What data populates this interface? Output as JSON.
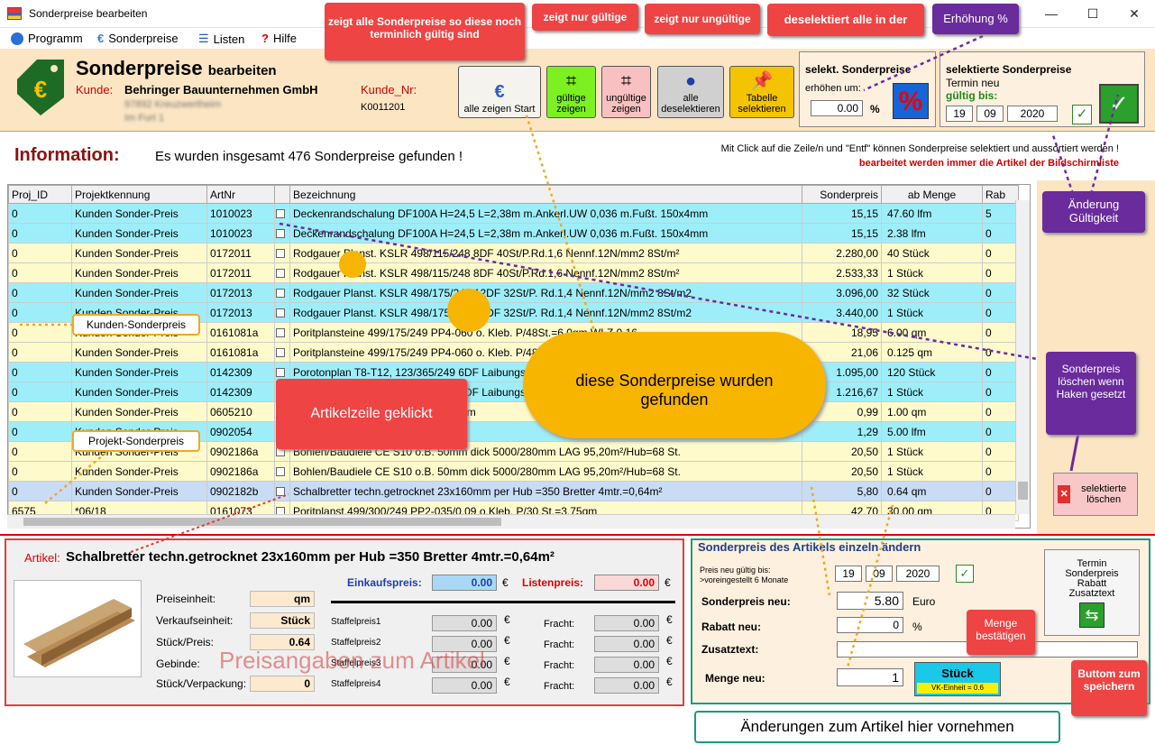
{
  "window": {
    "title": "Sonderpreise bearbeiten",
    "min": "—",
    "max": "☐",
    "close": "✕"
  },
  "menu": [
    {
      "label": "Programm",
      "color": "#2a6fd6"
    },
    {
      "label": "Sonderpreise",
      "color": "#3a7bd5"
    },
    {
      "label": "Listen",
      "color": "#1b5fb5"
    },
    {
      "label": "Hilfe",
      "color": "#d00000"
    }
  ],
  "header": {
    "title": "Sonderpreise",
    "title_suffix": "bearbeiten",
    "kunde_label": "Kunde:",
    "kunde_value": "Behringer Bauunternehmen GmbH",
    "address1": "97892 Kreuzwertheim",
    "address2": "Im Furt 1",
    "kundennr_label": "Kunde_Nr:",
    "kundennr_value": "K0011201"
  },
  "toolbar": {
    "alle_zeigen": "alle zeigen Start",
    "gueltige": "gültige zeigen",
    "ungueltige": "ungültige zeigen",
    "deselektieren": "alle deselektieren",
    "tabelle": "Tabelle selektieren"
  },
  "erhoehen": {
    "title": "selekt. Sonderpreise",
    "label": "erhöhen um:",
    "value": "0.00",
    "unit": "%"
  },
  "termin": {
    "title": "selektierte Sonderpreise",
    "line2": "Termin neu",
    "line3": "gültig bis:",
    "day": "19",
    "month": "09",
    "year": "2020"
  },
  "info": {
    "label": "Information:",
    "text": "Es wurden insgesamt  476  Sonderpreise gefunden !",
    "hint": "Mit Click auf die Zeile/n und \"Entf\" können Sonderpreise selektiert und aussortiert werden !",
    "hint2": "bearbeitet werden immer die Artikel der Bildschirmliste"
  },
  "table": {
    "columns": [
      "Proj_ID",
      "Projektkennung",
      "ArtNr",
      "",
      "Bezeichnung",
      "Sonderpreis",
      "ab Menge",
      "Rab"
    ],
    "rows": [
      {
        "style": "cyan",
        "c": [
          "0",
          "Kunden Sonder-Preis",
          "1010023",
          "Deckenrandschalung DF100A  H=24,5 L=2,38m  m.Ankerl.UW 0,036 m.Fußt. 150x4mm",
          "15,15",
          "47.60 lfm",
          "5"
        ]
      },
      {
        "style": "cyan",
        "c": [
          "0",
          "Kunden Sonder-Preis",
          "1010023",
          "Deckenrandschalung DF100A  H=24,5 L=2,38m  m.Ankerl.UW 0,036  m.Fußt.  150x4mm",
          "15,15",
          "2.38 lfm",
          "0"
        ]
      },
      {
        "style": "yel",
        "c": [
          "0",
          "Kunden Sonder-Preis",
          "0172011",
          "Rodgauer Planst.  KSLR 498/115/248   8DF 40St/P.Rd.1,6 Nennf.12N/mm2 8St/m²",
          "2.280,00",
          "40 Stück",
          "0"
        ]
      },
      {
        "style": "yel",
        "c": [
          "0",
          "Kunden Sonder-Preis",
          "0172011",
          "Rodgauer Planst.  KSLR 498/115/248   8DF 40St/P.Rd.1,6 Nennf.12N/mm2 8St/m²",
          "2.533,33",
          "1 Stück",
          "0"
        ]
      },
      {
        "style": "cyan",
        "c": [
          "0",
          "Kunden Sonder-Preis",
          "0172013",
          "Rodgauer Planst. KSLR 498/175/248  12DF 32St/P. Rd.1,4 Nennf.12N/mm2 8St/m2",
          "3.096,00",
          "32 Stück",
          "0"
        ]
      },
      {
        "style": "cyan",
        "c": [
          "0",
          "Kunden Sonder-Preis",
          "0172013",
          "Rodgauer Planst. KSLR 498/175/248  12DF 32St/P. Rd.1,4 Nennf.12N/mm2 8St/m2",
          "3.440,00",
          "1 Stück",
          "0"
        ]
      },
      {
        "style": "yel",
        "c": [
          "0",
          "Kunden Sonder-Preis",
          "0161081a",
          "Poritplansteine 499/175/249   PP4-060  o. Kleb. P/48St.=6,0qm WLZ 0,16",
          "18,95",
          "6.00 qm",
          "0"
        ]
      },
      {
        "style": "yel",
        "c": [
          "0",
          "Kunden Sonder-Preis",
          "0161081a",
          "Poritplansteine 499/175/249   PP4-060  o. Kleb. P/48St.",
          "21,06",
          "0.125 qm",
          "0"
        ]
      },
      {
        "style": "cyan",
        "c": [
          "0",
          "Kunden Sonder-Preis",
          "0142309",
          "Porotonplan T8-T12,   123/365/249 6DF Laibungsz.",
          "1.095,00",
          "120 Stück",
          "0"
        ]
      },
      {
        "style": "cyan",
        "c": [
          "0",
          "Kunden Sonder-Preis",
          "0142309",
          "Porotonplan T8-T12,   123/365/249 6DF Laibungsz.",
          "1.216,67",
          "1 Stück",
          "0"
        ]
      },
      {
        "style": "yel",
        "c": [
          "0",
          "Kunden Sonder-Preis",
          "0605210",
          "Bohlen/Baudiele CE S10 o.B. 36,5 cm",
          "0,99",
          "1.00 qm",
          "0"
        ]
      },
      {
        "style": "cyan",
        "c": [
          "0",
          "Kunden Sonder-Preis",
          "0902054",
          "Schalbretter techn.getr. 5,0",
          "1,29",
          "5.00 lfm",
          "0"
        ]
      },
      {
        "style": "yel",
        "c": [
          "0",
          "Kunden Sonder-Preis",
          "0902186a",
          "Bohlen/Baudiele CE S10 o.B. 50mm dick 5000/280mm LAG 95,20m²/Hub=68 St.",
          "20,50",
          "1 Stück",
          "0"
        ]
      },
      {
        "style": "yel",
        "c": [
          "0",
          "Kunden Sonder-Preis",
          "0902186a",
          "Bohlen/Baudiele CE S10 o.B. 50mm dick 5000/280mm LAG 95,20m²/Hub=68 St.",
          "20,50",
          "1 Stück",
          "0"
        ]
      },
      {
        "style": "sel",
        "c": [
          "0",
          "Kunden Sonder-Preis",
          "0902182b",
          "Schalbretter techn.getrocknet 23x160mm per Hub =350 Bretter 4mtr.=0,64m²",
          "5,80",
          "0.64 qm",
          "0"
        ]
      },
      {
        "style": "yel",
        "c": [
          "6575",
          "*06/18",
          "0161073",
          "Poritplanst.499/300/249  PP2-035/0,09 o.Kleb. P/30 St.=3,75qm",
          "42,70",
          "30.00 qm",
          "0"
        ]
      }
    ]
  },
  "delete_button": "selektierte löschen",
  "artikel": {
    "label": "Artikel:",
    "name": "Schalbretter techn.getrocknet 23x160mm per Hub =350 Bretter 4mtr.=0,64m²",
    "einkauf_label": "Einkaufspreis:",
    "einkauf_value": "0.00",
    "listen_label": "Listenpreis:",
    "listen_value": "0.00",
    "currency": "€",
    "preiseinheit_label": "Preiseinheit:",
    "preiseinheit_value": "qm",
    "verkaufseinheit_label": "Verkaufseinheit:",
    "verkaufseinheit_value": "Stück",
    "stueck_preis_label": "Stück/Preis:",
    "stueck_preis_value": "0.64",
    "gebinde_label": "Gebinde:",
    "stueck_verpackung_label": "Stück/Verpackung:",
    "stueck_verpackung_value": "0",
    "staffel": [
      {
        "label": "Staffelpreis1",
        "value": "0.00",
        "fracht": "0.00"
      },
      {
        "label": "Staffelpreis2",
        "value": "0.00",
        "fracht": "0.00"
      },
      {
        "label": "Staffelpreis3",
        "value": "0.00",
        "fracht": "0.00"
      },
      {
        "label": "Staffelpreis4",
        "value": "0.00",
        "fracht": "0.00"
      }
    ],
    "fracht_label": "Fracht:",
    "watermark": "Preisangaben zum Artikel"
  },
  "einzel": {
    "title": "Sonderpreis des Artikels einzeln ändern",
    "gueltig_label1": "Preis neu gültig bis:",
    "gueltig_label2": ">voreingestellt 6 Monate",
    "day": "19",
    "month": "09",
    "year": "2020",
    "sonderpreis_label": "Sonderpreis neu:",
    "sonderpreis_value": "5.80",
    "sonderpreis_unit": "Euro",
    "rabatt_label": "Rabatt neu:",
    "rabatt_value": "0",
    "rabatt_unit": "%",
    "zusatz_label": "Zusatztext:",
    "zusatz_value": "",
    "menge_label": "Menge neu:",
    "menge_value": "1",
    "einheit_button": "Stück",
    "einheit_sub": "VK-Einheit = 0.6",
    "speichern_button": "Termin Sonderpreis Rabatt Zusatztext"
  },
  "callouts": {
    "alle": "zeigt alle Sonderpreise so diese noch terminlich gültig sind",
    "gueltig": "zeigt nur gültige",
    "ungueltig": "zeigt nur ungültige",
    "deselekt": "deselektiert alle in der",
    "erhoehung": "Erhöhung %",
    "aenderung": "Änderung Gültigkeit",
    "loeschen": "Sonderpreis löschen wenn Haken gesetzt",
    "kunden_sp": "Kunden-Sonderpreis",
    "projekt_sp": "Projekt-Sonderpreis",
    "geklickt": "Artikelzeile geklickt",
    "cloud": "diese Sonderpreise wurden gefunden",
    "menge": "Menge bestätigen",
    "buttom": "Buttom zum speichern",
    "aenderungen": "Änderungen zum Artikel hier vornehmen"
  }
}
